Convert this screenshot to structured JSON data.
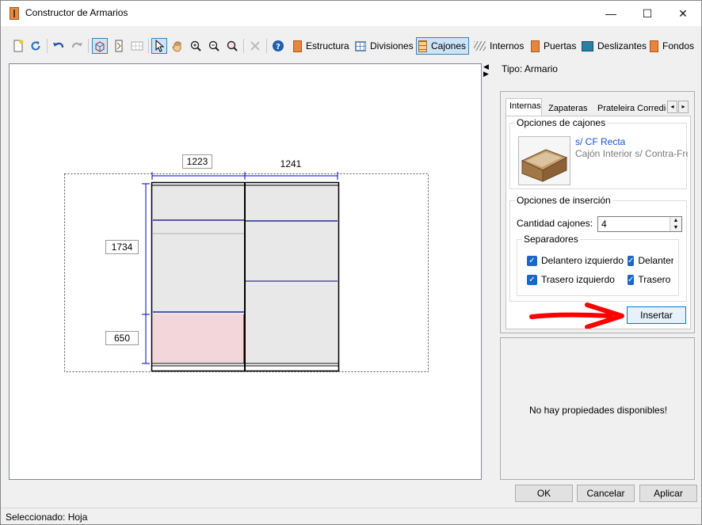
{
  "window": {
    "title": "Constructor de Armarios",
    "controls": {
      "minimize": "—",
      "maximize": "☐",
      "close": "✕"
    }
  },
  "toolbar": {
    "icon_buttons": [
      "new-document-icon",
      "refresh-icon",
      "undo-icon",
      "redo-icon",
      "view-3d-icon",
      "view-front-icon",
      "view-plan-icon",
      "select-pointer-icon",
      "pan-hand-icon",
      "zoom-in-icon",
      "zoom-out-icon",
      "zoom-fit-icon",
      "delete-icon",
      "help-icon"
    ],
    "text_buttons": [
      {
        "label": "Estructura",
        "icon": "structure-icon"
      },
      {
        "label": "Divisiones",
        "icon": "divisions-icon"
      },
      {
        "label": "Cajones",
        "icon": "drawers-icon",
        "pressed": true
      },
      {
        "label": "Internos",
        "icon": "internals-icon"
      },
      {
        "label": "Puertas",
        "icon": "doors-icon"
      },
      {
        "label": "Deslizantes",
        "icon": "sliding-icon"
      },
      {
        "label": "Fondos",
        "icon": "backs-icon"
      }
    ]
  },
  "canvas": {
    "dims": {
      "width_left": "1223",
      "width_right": "1241",
      "height_upper": "1734",
      "height_lower": "650"
    },
    "colors": {
      "frame": "#000000",
      "panel": "#e8e8e8",
      "division_line": "#00008b",
      "selected_fill": "#f3d6d9",
      "dim_line": "#0000cc"
    }
  },
  "side": {
    "collapse_up": "◀",
    "collapse_down": "▶",
    "tipo_label": "Tipo: Armario"
  },
  "panel": {
    "tabs": [
      "Internas",
      "Zapateras",
      "Prateleira Corrediça"
    ],
    "active_tab": "Internas",
    "tab_scroll": {
      "left": "◂",
      "right": "▸"
    },
    "drawer_options": {
      "title": "Opciones de cajones",
      "selected_name": "s/ CF Recta",
      "selected_desc": "Cajón Interior s/ Contra-Frente"
    },
    "insertion_options": {
      "title": "Opciones de inserción",
      "quantity_label": "Cantidad cajones:",
      "quantity_value": "4",
      "spin_up": "▲",
      "spin_down": "▼",
      "separators_title": "Separadores",
      "separators": [
        {
          "label": "Delantero izquierdo",
          "checked": true
        },
        {
          "label": "Delantero derecho",
          "checked": true
        },
        {
          "label": "Trasero izquierdo",
          "checked": true
        },
        {
          "label": "Trasero derecho",
          "checked": true
        }
      ],
      "check_mark": "✓"
    },
    "insert_button": "Insertar",
    "annotation_color": "#ff0000"
  },
  "properties": {
    "empty_text": "No hay propiedades disponibles!"
  },
  "footer": {
    "ok": "OK",
    "cancel": "Cancelar",
    "apply": "Aplicar"
  },
  "status": {
    "text": "Seleccionado: Hoja"
  }
}
